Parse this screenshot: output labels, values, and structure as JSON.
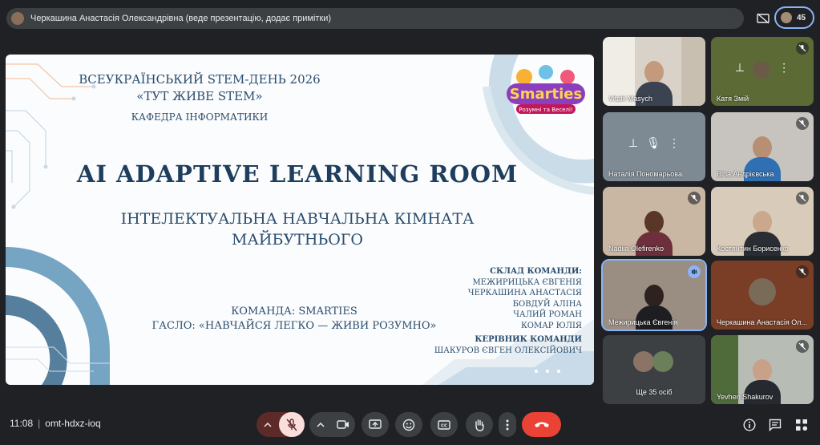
{
  "top_bar": {
    "presenter_text": "Черкашина Анастасія Олександрівна (веде презентацію, додає примітки)",
    "participants_count": "45"
  },
  "slide": {
    "line1": "ВСЕУКРАЇНСЬКИЙ STEM-ДЕНЬ 2026",
    "line2": "«ТУТ ЖИВЕ STEM»",
    "line3": "КАФЕДРА ІНФОРМАТИКИ",
    "title": "AI ADAPTIVE LEARNING ROOM",
    "subtitle1": "ІНТЕЛЕКТУАЛЬНА НАВЧАЛЬНА КІМНАТА",
    "subtitle2": "МАЙБУТНЬОГО",
    "team": "КОМАНДА: SMARTIES",
    "motto": "ГАСЛО: «НАВЧАЙСЯ ЛЕГКО — ЖИВИ РОЗУМНО»",
    "members_heading": "СКЛАД КОМАНДИ:",
    "members": [
      "МЕЖИРИЦЬКА ЄВГЕНІЯ",
      "ЧЕРКАШИНА АНАСТАСІЯ",
      "БОВДУЙ АЛІНА",
      "ЧАЛИЙ РОМАН",
      "КОМАР ЮЛІЯ"
    ],
    "leader_heading": "КЕРІВНИК КОМАНДИ",
    "leader": "ШАКУРОВ ЄВГЕН ОЛЕКСІЙОВИЧ",
    "logo_text": "Smarties",
    "logo_tagline": "Розумні та Веселі!"
  },
  "participants": [
    {
      "name": "Vitalii Masych"
    },
    {
      "name": "Катя Змій"
    },
    {
      "name": "Наталія Пономарьова"
    },
    {
      "name": "Віра Андрієвська"
    },
    {
      "name": "Nadiia Olefirenko"
    },
    {
      "name": "Костянтин Борисенко"
    },
    {
      "name": "Межирицька Євгенія"
    },
    {
      "name": "Черкашина Анастасія Ол..."
    },
    {
      "name": "Ще 35 осіб"
    },
    {
      "name": "Yevhen Shakurov"
    }
  ],
  "bottom_bar": {
    "time": "11:08",
    "meeting_code": "omt-hdxz-ioq"
  },
  "colors": {
    "background": "#202124",
    "accent": "#8ab4f8",
    "end_call": "#ea4335",
    "mic_off_bg": "#f9dedc",
    "slide_text": "#2a4d6e"
  }
}
